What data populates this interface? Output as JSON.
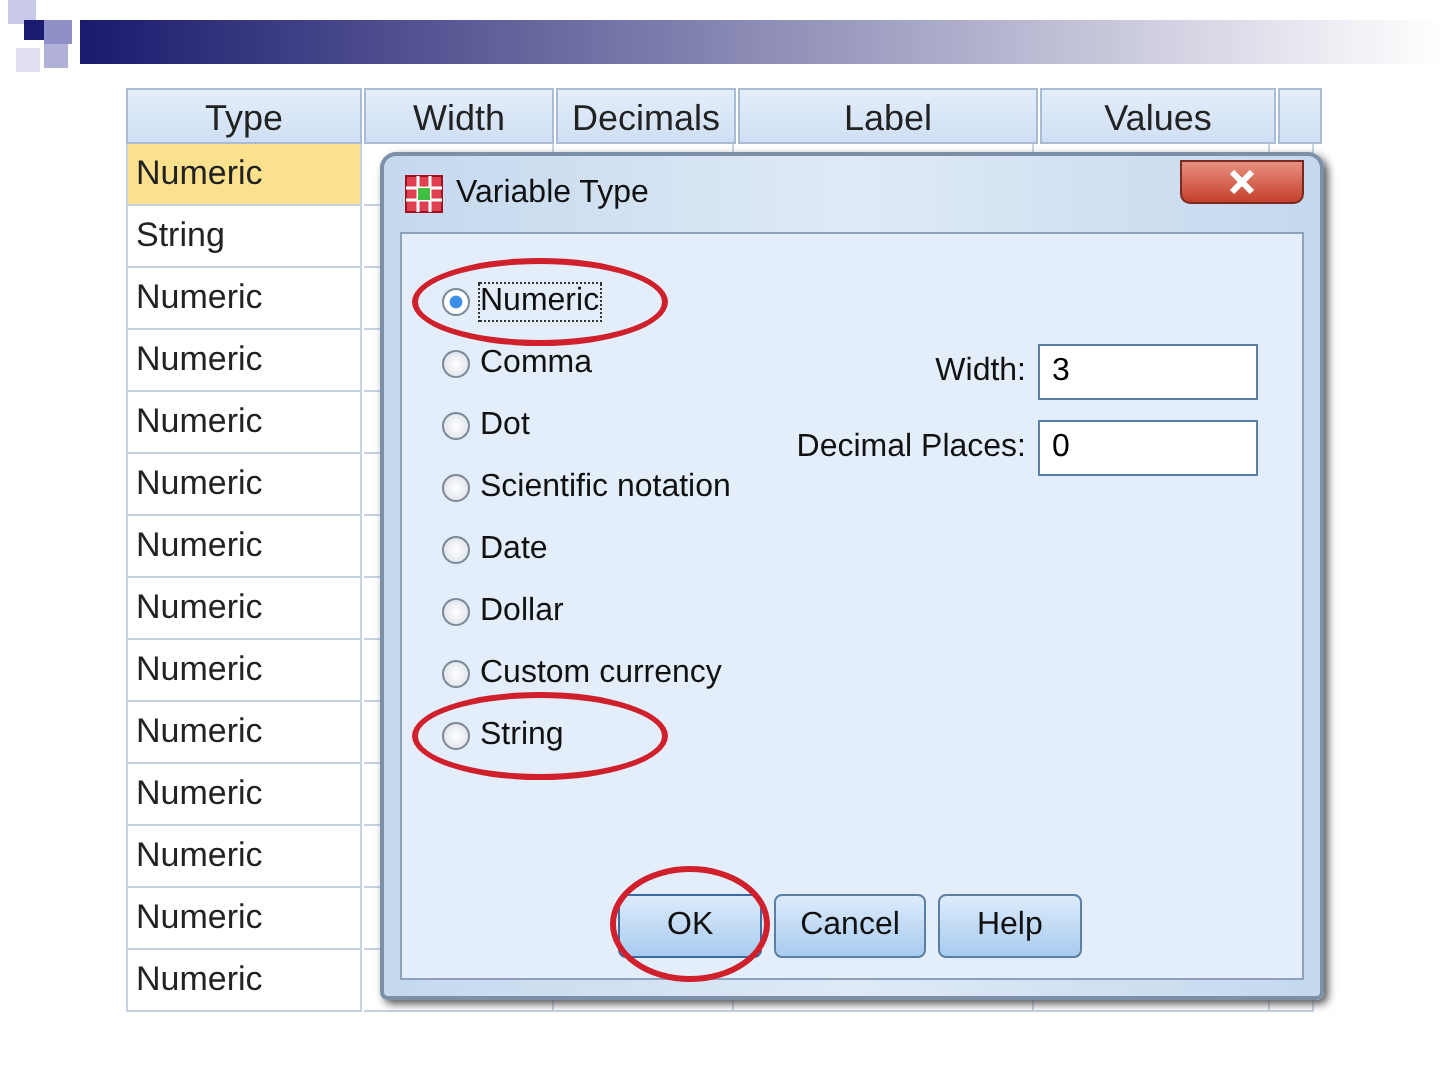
{
  "table": {
    "columns": [
      "Type",
      "Width",
      "Decimals",
      "Label",
      "Values"
    ],
    "rows": [
      {
        "type": "Numeric",
        "selected": true
      },
      {
        "type": "String",
        "selected": false
      },
      {
        "type": "Numeric",
        "selected": false
      },
      {
        "type": "Numeric",
        "selected": false
      },
      {
        "type": "Numeric",
        "selected": false
      },
      {
        "type": "Numeric",
        "selected": false
      },
      {
        "type": "Numeric",
        "selected": false
      },
      {
        "type": "Numeric",
        "selected": false
      },
      {
        "type": "Numeric",
        "selected": false
      },
      {
        "type": "Numeric",
        "selected": false
      },
      {
        "type": "Numeric",
        "selected": false
      },
      {
        "type": "Numeric",
        "selected": false
      },
      {
        "type": "Numeric",
        "selected": false
      },
      {
        "type": "Numeric",
        "selected": false
      }
    ]
  },
  "dialog": {
    "title": "Variable Type",
    "options": [
      {
        "label": "Numeric",
        "selected": true,
        "circled": true
      },
      {
        "label": "Comma",
        "selected": false,
        "circled": false
      },
      {
        "label": "Dot",
        "selected": false,
        "circled": false
      },
      {
        "label": "Scientific notation",
        "selected": false,
        "circled": false
      },
      {
        "label": "Date",
        "selected": false,
        "circled": false
      },
      {
        "label": "Dollar",
        "selected": false,
        "circled": false
      },
      {
        "label": "Custom currency",
        "selected": false,
        "circled": false
      },
      {
        "label": "String",
        "selected": false,
        "circled": true
      }
    ],
    "fields": [
      {
        "label": "Width:",
        "value": "3"
      },
      {
        "label": "Decimal Places:",
        "value": "0"
      }
    ],
    "buttons": [
      {
        "label": "OK",
        "circled": true
      },
      {
        "label": "Cancel",
        "circled": false
      },
      {
        "label": "Help",
        "circled": false
      }
    ]
  }
}
